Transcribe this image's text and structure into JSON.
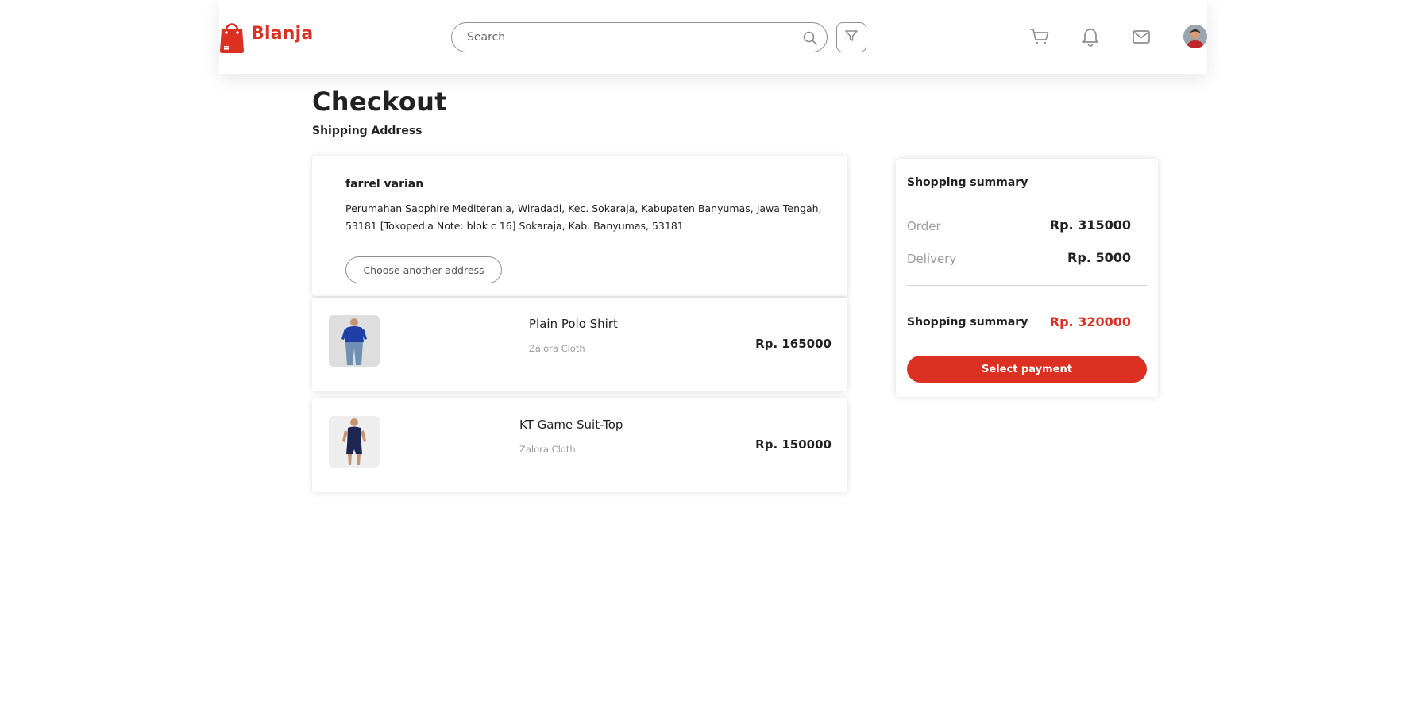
{
  "header": {
    "brand": "Blanja",
    "search": {
      "placeholder": "Search",
      "value": ""
    },
    "icons": [
      "search-icon",
      "filter-icon",
      "cart-icon",
      "bell-icon",
      "mail-icon"
    ]
  },
  "page": {
    "title": "Checkout",
    "section_label": "Shipping Address"
  },
  "address": {
    "name": "farrel varian",
    "text": "Perumahan Sapphire Mediterania, Wiradadi, Kec. Sokaraja, Kabupaten Banyumas, Jawa Tengah, 53181 [Tokopedia Note: blok c 16] Sokaraja, Kab. Banyumas, 53181",
    "choose_label": "Choose another address"
  },
  "items": [
    {
      "name": "Plain Polo Shirt",
      "store": "Zalora Cloth",
      "price": "Rp. 165000"
    },
    {
      "name": "KT Game Suit-Top",
      "store": "Zalora Cloth",
      "price": "Rp. 150000"
    }
  ],
  "summary": {
    "title": "Shopping summary",
    "order_label": "Order",
    "order_value": "Rp. 315000",
    "delivery_label": "Delivery",
    "delivery_value": "Rp. 5000",
    "total_label": "Shopping summary",
    "total_value": "Rp. 320000",
    "button_label": "Select payment"
  },
  "colors": {
    "primary": "#DB3022",
    "muted": "#9B9B9B",
    "text": "#222222"
  }
}
